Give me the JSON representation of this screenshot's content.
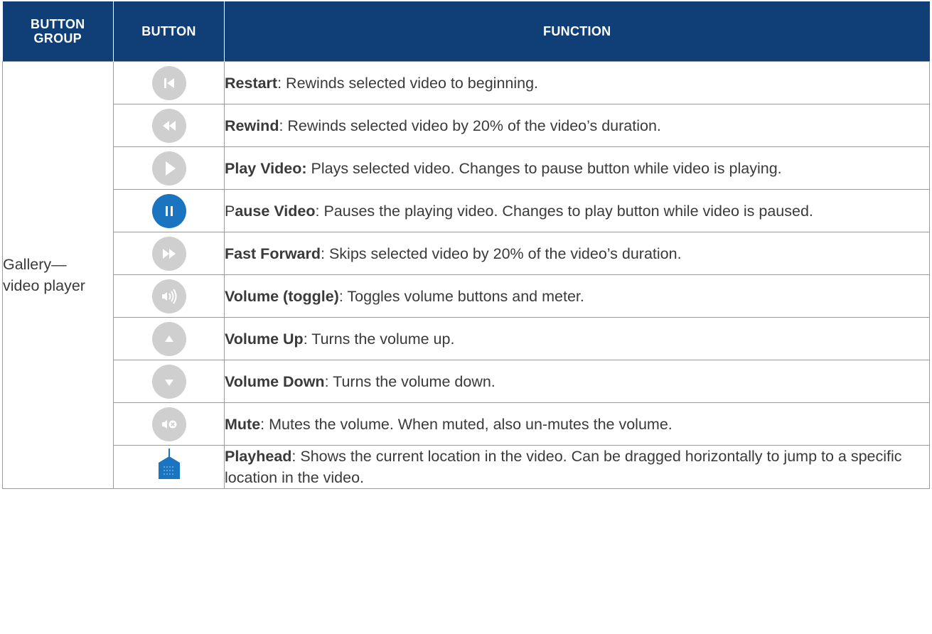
{
  "header": {
    "group_label": "BUTTON\nGROUP",
    "button_label": "BUTTON",
    "function_label": "FUNCTION"
  },
  "group": "Gallery—\nvideo player",
  "colors": {
    "header_bg": "#0f3f76",
    "icon_inactive": "#cfcfcf",
    "icon_active": "#1a74bf"
  },
  "rows": [
    {
      "icon": "restart-icon",
      "name": "Restart",
      "sep": ": ",
      "desc": "Rewinds selected video to beginning."
    },
    {
      "icon": "rewind-icon",
      "name": "Rewind",
      "sep": ": ",
      "desc": "Rewinds selected video by 20% of the video’s duration."
    },
    {
      "icon": "play-icon",
      "name": "Play Video:",
      "sep": " ",
      "desc": "Plays selected video. Changes to pause button while video is playing."
    },
    {
      "icon": "pause-icon",
      "name_prefix": "P",
      "name": "ause Video",
      "sep": ": ",
      "desc": "Pauses the playing video. Changes to play button while video is paused."
    },
    {
      "icon": "fast-forward-icon",
      "name": "Fast Forward",
      "sep": ": ",
      "desc": "Skips selected video by 20% of the video’s duration."
    },
    {
      "icon": "volume-toggle-icon",
      "name": "Volume (toggle)",
      "sep": ": ",
      "desc": "Toggles volume buttons and meter."
    },
    {
      "icon": "volume-up-icon",
      "name": "Volume Up",
      "sep": ": ",
      "desc": "Turns the volume up."
    },
    {
      "icon": "volume-down-icon",
      "name": "Volume Down",
      "sep": ": ",
      "desc": "Turns the volume down."
    },
    {
      "icon": "mute-icon",
      "name": "Mute",
      "sep": ": ",
      "desc": "Mutes the volume. When muted, also un-mutes the volume."
    },
    {
      "icon": "playhead-icon",
      "name": "Playhead",
      "sep": ": ",
      "desc": "Shows the current location in the video. Can be dragged horizontally to jump to a specific location in the video."
    }
  ]
}
